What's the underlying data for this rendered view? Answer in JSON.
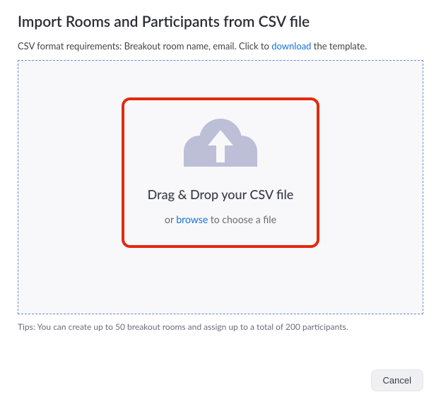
{
  "title": "Import Rooms and Participants from CSV file",
  "subtitle": {
    "prefix": "CSV format requirements: Breakout room name, email. Click to ",
    "download_label": "download",
    "suffix": " the template."
  },
  "dropzone": {
    "heading": "Drag & Drop your CSV file",
    "sub_prefix": "or ",
    "browse_label": "browse",
    "sub_suffix": " to choose a file"
  },
  "tips": "Tips: You can create up to 50 breakout rooms and assign up to a total of 200 participants.",
  "footer": {
    "cancel_label": "Cancel"
  }
}
